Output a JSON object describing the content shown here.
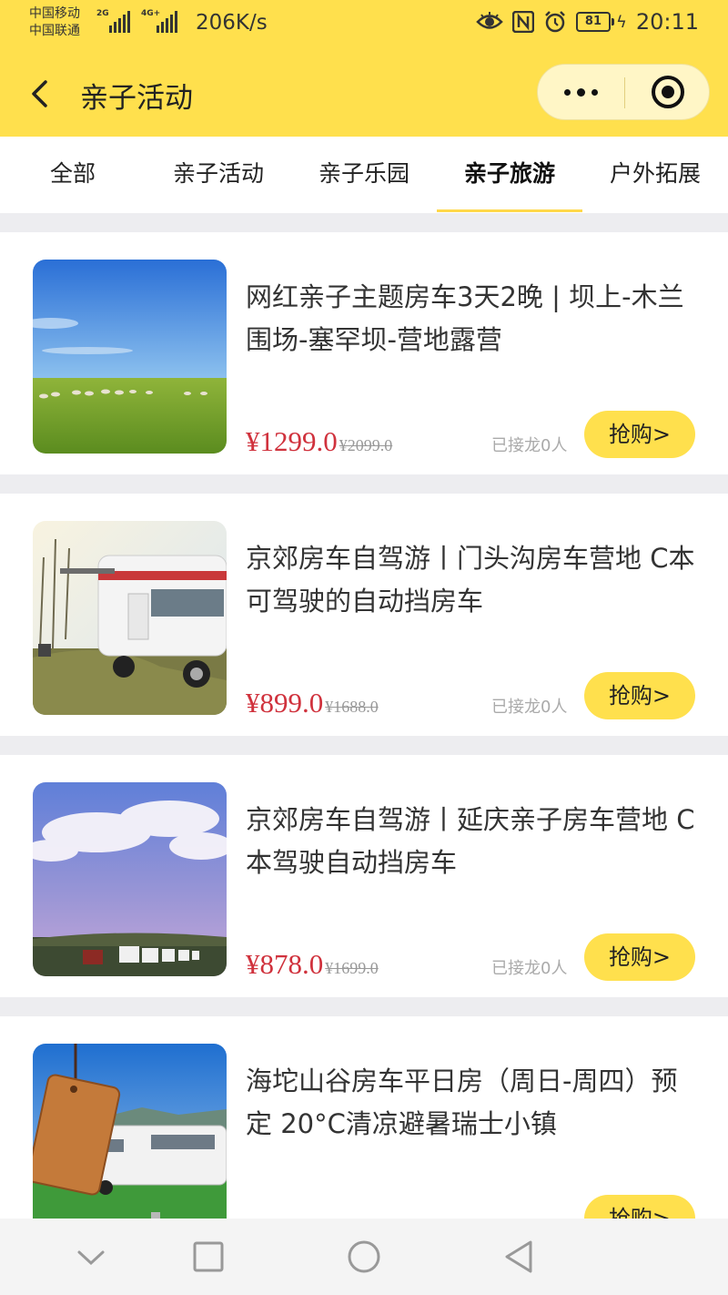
{
  "status_bar": {
    "carrier_1": "中国移动",
    "carrier_2": "中国联通",
    "sig1_label": "2G",
    "sig2_label": "4G+",
    "net_speed": "206K/s",
    "battery": "81",
    "time": "20:11",
    "icons": [
      "eye-icon",
      "nfc-icon",
      "alarm-icon",
      "battery-icon",
      "charging-icon"
    ]
  },
  "nav": {
    "title": "亲子活动",
    "back_icon": "chevron-left-icon",
    "more_icon": "more-dots-icon",
    "close_icon": "target-close-icon"
  },
  "tabs": [
    {
      "label": "全部"
    },
    {
      "label": "亲子活动"
    },
    {
      "label": "亲子乐园"
    },
    {
      "label": "亲子旅游",
      "active": true
    },
    {
      "label": "户外拓展"
    }
  ],
  "products": [
    {
      "title": "网红亲子主题房车3天2晚 | 坝上-木兰围场-塞罕坝-营地露营",
      "price": "¥1299.0",
      "old_price": "¥2099.0",
      "joined": "已接龙0人",
      "button": "抢购>"
    },
    {
      "title": "京郊房车自驾游丨门头沟房车营地 C本可驾驶的自动挡房车",
      "price": "¥899.0",
      "old_price": "¥1688.0",
      "joined": "已接龙0人",
      "button": "抢购>"
    },
    {
      "title": "京郊房车自驾游丨延庆亲子房车营地 C本驾驶自动挡房车",
      "price": "¥878.0",
      "old_price": "¥1699.0",
      "joined": "已接龙0人",
      "button": "抢购>"
    },
    {
      "title": "海坨山谷房车平日房（周日-周四）预定 20°C清凉避暑瑞士小镇",
      "price": "",
      "old_price": "",
      "joined": "",
      "button": "抢购>"
    }
  ],
  "system_nav": {
    "icons": [
      "collapse-chevron-icon",
      "recent-apps-icon",
      "home-icon",
      "back-triangle-icon"
    ]
  },
  "colors": {
    "brand_yellow": "#ffe04d",
    "price_red": "#d0323d"
  }
}
